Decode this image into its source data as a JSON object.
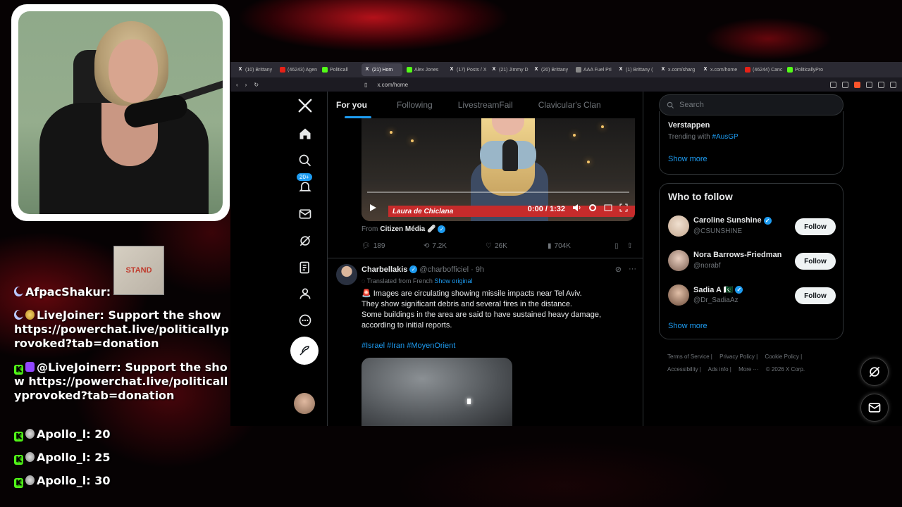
{
  "chat": {
    "messages": [
      {
        "user": "AfpacShakur:",
        "text": ""
      },
      {
        "user": "LiveJoiner:",
        "text": "Support the show https://powerchat.live/politicallyprovoked?tab=donation"
      },
      {
        "user": "@LiveJoinerr:",
        "text": "Support the show https://powerchat.live/politicallyprovoked?tab=donation"
      },
      {
        "user": "Apollo_l:",
        "text": "20"
      },
      {
        "user": "Apollo_l:",
        "text": "25"
      },
      {
        "user": "Apollo_l:",
        "text": "30"
      }
    ],
    "emote_label": "STAND"
  },
  "browser": {
    "tabs": [
      {
        "label": "(10) Brittany",
        "icon": "x"
      },
      {
        "label": "(46243) Agen",
        "icon": "yt"
      },
      {
        "label": "Politicall",
        "icon": "green"
      },
      {
        "label": "(21) Hom",
        "icon": "x",
        "active": true
      },
      {
        "label": "Alex Jones",
        "icon": "green"
      },
      {
        "label": "(17) Posts / X",
        "icon": "x"
      },
      {
        "label": "(21) Jimmy D",
        "icon": "x"
      },
      {
        "label": "(20) Brittany",
        "icon": "x"
      },
      {
        "label": "AAA Fuel Pri",
        "icon": "gray"
      },
      {
        "label": "(1) Brittany (",
        "icon": "x"
      },
      {
        "label": "x.com/sharg",
        "icon": "x"
      },
      {
        "label": "x.com/home",
        "icon": "x"
      },
      {
        "label": "(46244) Canc",
        "icon": "yt"
      },
      {
        "label": "PoliticallyPro",
        "icon": "green"
      }
    ],
    "url": "x.com/home"
  },
  "nav": {
    "notification_count": "20+"
  },
  "timeline": {
    "tabs": [
      "For you",
      "Following",
      "LivestreamFail",
      "Clavicular's Clan"
    ],
    "tweet1": {
      "video_time": "0:00 / 1:32",
      "lower_third": "Laura de Chiclana",
      "from_prefix": "From",
      "from_source": "Citizen Média 🩹",
      "replies": "189",
      "reposts": "7.2K",
      "likes": "26K",
      "views": "704K"
    },
    "tweet2": {
      "name": "Charbellakis",
      "handle": "@charbofficiel",
      "time": "· 9h",
      "translated": "Translated from French",
      "show_original": "Show original",
      "line1": "🚨 Images are circulating showing missile impacts near Tel Aviv.",
      "line2": "They show significant debris and several fires in the distance.",
      "line3": "Some buildings in the area are said to have sustained heavy damage, according to initial reports.",
      "hashtags": "#Israel #Iran #MoyenOrient"
    }
  },
  "sidebar": {
    "search_placeholder": "Search",
    "trend_name": "Verstappen",
    "trend_with_prefix": "Trending with",
    "trend_with_tag": "#AusGP",
    "show_more": "Show more",
    "who_to_follow": "Who to follow",
    "follow_label": "Follow",
    "suggestions": [
      {
        "name": "Caroline Sunshine",
        "handle": "@CSUNSHINE",
        "verified": true
      },
      {
        "name": "Nora Barrows-Friedman",
        "handle": "@norabf",
        "verified": false
      },
      {
        "name": "Sadia A 🇵🇰",
        "handle": "@Dr_SadiaAz",
        "verified": true
      }
    ],
    "footer": [
      "Terms of Service |",
      "Privacy Policy |",
      "Cookie Policy |",
      "Accessibility |",
      "Ads info |",
      "More ···",
      "© 2026 X Corp."
    ]
  },
  "colors": {
    "accent": "#1d9bf0",
    "background": "#000000",
    "border": "#2f3336"
  }
}
